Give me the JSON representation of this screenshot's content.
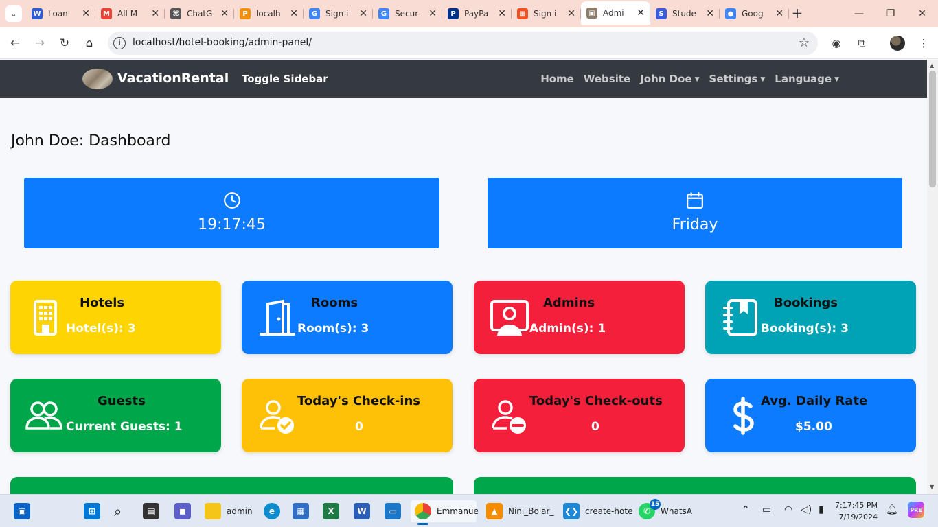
{
  "browser": {
    "tabs": [
      {
        "title": "Loan",
        "fav_color": "#2f5bd3",
        "fav_glyph": "W"
      },
      {
        "title": "All M",
        "fav_color": "#ea4335",
        "fav_glyph": "M"
      },
      {
        "title": "ChatG",
        "fav_color": "#555555",
        "fav_glyph": "⌘"
      },
      {
        "title": "localh",
        "fav_color": "#f29111",
        "fav_glyph": "P"
      },
      {
        "title": "Sign i",
        "fav_color": "#4285f4",
        "fav_glyph": "G"
      },
      {
        "title": "Secur",
        "fav_color": "#4285f4",
        "fav_glyph": "G"
      },
      {
        "title": "PayPa",
        "fav_color": "#003087",
        "fav_glyph": "P"
      },
      {
        "title": "Sign i",
        "fav_color": "#f25022",
        "fav_glyph": "▦"
      },
      {
        "title": "Admi",
        "fav_color": "#8d7d68",
        "fav_glyph": "▣",
        "active": true
      },
      {
        "title": "Stude",
        "fav_color": "#3b5bdb",
        "fav_glyph": "S"
      },
      {
        "title": "Goog",
        "fav_color": "#4285f4",
        "fav_glyph": "●"
      }
    ],
    "close_glyph": "✕",
    "new_tab_glyph": "+",
    "url": "localhost/hotel-booking/admin-panel/"
  },
  "app": {
    "brand": "VacationRental",
    "toggle_sidebar": "Toggle Sidebar",
    "nav": {
      "home": "Home",
      "website": "Website",
      "user": "John Doe",
      "settings": "Settings",
      "language": "Language"
    },
    "page_title": "John Doe: Dashboard",
    "clock_time": "19:17:45",
    "day_name": "Friday",
    "cards": {
      "hotels": {
        "title": "Hotels",
        "value": "Hotel(s):  3"
      },
      "rooms": {
        "title": "Rooms",
        "value": "Room(s):  3"
      },
      "admins": {
        "title": "Admins",
        "value": "Admin(s):  1"
      },
      "bookings": {
        "title": "Bookings",
        "value": "Booking(s):  3"
      },
      "guests": {
        "title": "Guests",
        "value": "Current Guests: 1"
      },
      "checkins": {
        "title": "Today's Check-ins",
        "value": "0"
      },
      "checkouts": {
        "title": "Today's Check-outs",
        "value": "0"
      },
      "adr": {
        "title": "Avg. Daily Rate",
        "value": "$5.00"
      }
    },
    "colors": {
      "yellow": "#ffd400",
      "blue": "#0d7bff",
      "red": "#f41f3a",
      "teal": "#00a3b6",
      "green": "#00a64a",
      "amber": "#ffc107",
      "navbar": "#343a40"
    }
  },
  "taskbar": {
    "explorer_label": "admin",
    "chrome_label": "Emmanue",
    "vlc_label": "Nini_Bolar_",
    "vscode_label": "create-hote",
    "whatsapp_label": "WhatsA",
    "whatsapp_badge": "15",
    "time": "7:17:45 PM",
    "date": "7/19/2024"
  }
}
